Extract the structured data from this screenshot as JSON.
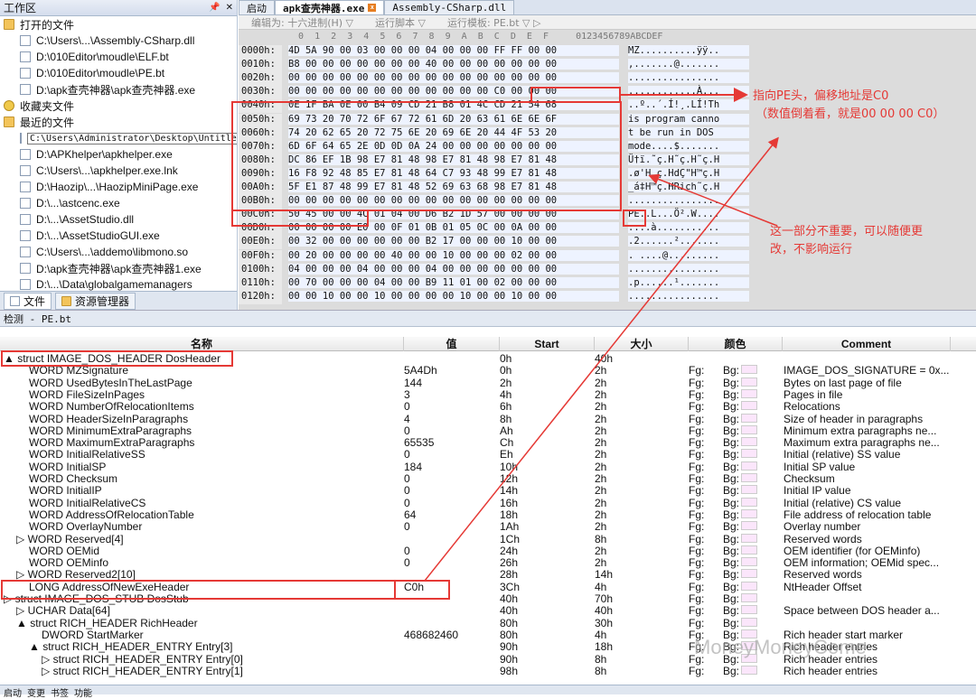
{
  "left_panel": {
    "title": "工作区",
    "sections": [
      {
        "label": "打开的文件",
        "icon": "folder-icon"
      },
      {
        "label": "收藏夹文件",
        "icon": "folder-icon"
      },
      {
        "label": "最近的文件",
        "icon": "folder-icon"
      }
    ],
    "open_files": [
      "C:\\Users\\...\\Assembly-CSharp.dll",
      "D:\\010Editor\\moudle\\ELF.bt",
      "D:\\010Editor\\moudle\\PE.bt",
      "D:\\apk查壳神器\\apk查壳神器.exe"
    ],
    "recent_files": [
      "C:\\Users\\Administrator\\Desktop\\Untitled",
      "D:\\APKhelper\\apkhelper.exe",
      "C:\\Users\\...\\apkhelper.exe.lnk",
      "D:\\Haozip\\...\\HaozipMiniPage.exe",
      "D:\\...\\astcenc.exe",
      "D:\\...\\AssetStudio.dll",
      "D:\\...\\AssetStudioGUI.exe",
      "C:\\Users\\...\\addemo\\libmono.so",
      "D:\\apk查壳神器\\apk查壳神器1.exe",
      "D:\\...\\Data\\globalgamemanagers"
    ],
    "tabs": [
      "文件",
      "资源管理器"
    ]
  },
  "hex_editor": {
    "tabs": [
      "启动",
      "apk查壳神器.exe",
      "Assembly-CSharp.dll"
    ],
    "toolbar": [
      "编辑为: 十六进制(H) ▽",
      "运行脚本 ▽",
      "运行模板: PE.bt ▽ ▷"
    ],
    "col_header": "  0  1  2  3  4  5  6  7  8  9  A  B  C  D  E  F     0123456789ABCDEF",
    "rows": [
      {
        "addr": "0000h:",
        "bytes": "4D 5A 90 00 03 00 00 00 04 00 00 00 FF FF 00 00",
        "ascii": "MZ..........ÿÿ.."
      },
      {
        "addr": "0010h:",
        "bytes": "B8 00 00 00 00 00 00 00 40 00 00 00 00 00 00 00",
        "ascii": ",.......@......."
      },
      {
        "addr": "0020h:",
        "bytes": "00 00 00 00 00 00 00 00 00 00 00 00 00 00 00 00",
        "ascii": "................"
      },
      {
        "addr": "0030h:",
        "bytes": "00 00 00 00 00 00 00 00 00 00 00 00 C0 00 00 00",
        "ascii": "............À..."
      },
      {
        "addr": "0040h:",
        "bytes": "0E 1F BA 0E 00 B4 09 CD 21 B8 01 4C CD 21 54 68",
        "ascii": "..º..´.Í!¸.LÍ!Th"
      },
      {
        "addr": "0050h:",
        "bytes": "69 73 20 70 72 6F 67 72 61 6D 20 63 61 6E 6E 6F",
        "ascii": "is program canno"
      },
      {
        "addr": "0060h:",
        "bytes": "74 20 62 65 20 72 75 6E 20 69 6E 20 44 4F 53 20",
        "ascii": "t be run in DOS "
      },
      {
        "addr": "0070h:",
        "bytes": "6D 6F 64 65 2E 0D 0D 0A 24 00 00 00 00 00 00 00",
        "ascii": "mode....$......."
      },
      {
        "addr": "0080h:",
        "bytes": "DC 86 EF 1B 98 E7 81 48 98 E7 81 48 98 E7 81 48",
        "ascii": "Ü†ï.˜ç.H˜ç.H˜ç.H"
      },
      {
        "addr": "0090h:",
        "bytes": "16 F8 92 48 85 E7 81 48 64 C7 93 48 99 E7 81 48",
        "ascii": ".ø'H…ç.HdÇ\"H™ç.H"
      },
      {
        "addr": "00A0h:",
        "bytes": "5F E1 87 48 99 E7 81 48 52 69 63 68 98 E7 81 48",
        "ascii": "_á‡H™ç.HRich˜ç.H"
      },
      {
        "addr": "00B0h:",
        "bytes": "00 00 00 00 00 00 00 00 00 00 00 00 00 00 00 00",
        "ascii": "................"
      },
      {
        "addr": "00C0h:",
        "bytes": "50 45 00 00 4C 01 04 00 D6 B2 1D 57 00 00 00 00",
        "ascii": "PE..L...Ö².W...."
      },
      {
        "addr": "00D0h:",
        "bytes": "00 00 00 00 E0 00 0F 01 0B 01 05 0C 00 0A 00 00",
        "ascii": "....à..........."
      },
      {
        "addr": "00E0h:",
        "bytes": "00 32 00 00 00 00 00 00 B2 17 00 00 00 10 00 00",
        "ascii": ".2......²......."
      },
      {
        "addr": "00F0h:",
        "bytes": "00 20 00 00 00 00 40 00 00 10 00 00 00 02 00 00",
        "ascii": ". ....@........."
      },
      {
        "addr": "0100h:",
        "bytes": "04 00 00 00 04 00 00 00 04 00 00 00 00 00 00 00",
        "ascii": "................"
      },
      {
        "addr": "0110h:",
        "bytes": "00 70 00 00 00 04 00 00 B9 11 01 00 02 00 00 00",
        "ascii": ".p......¹......."
      },
      {
        "addr": "0120h:",
        "bytes": "00 00 10 00 00 10 00 00 00 00 10 00 00 10 00 00",
        "ascii": "................"
      }
    ]
  },
  "annotations": {
    "pe_head": "指向PE头，偏移地址是C0",
    "pe_head2": "（数值倒着看，就是00 00 00 C0）",
    "stub_note": "这一部分不重要，可以随便更",
    "stub_note2": "改，不影响运行"
  },
  "inspector": {
    "title": "检测 - PE.bt",
    "headers": [
      "名称",
      "值",
      "Start",
      "大小",
      "颜色",
      "Comment"
    ],
    "rows": [
      {
        "indent": 0,
        "exp": "▲",
        "name": "struct IMAGE_DOS_HEADER DosHeader",
        "val": "",
        "start": "0h",
        "size": "40h",
        "fg": "",
        "bg": "",
        "cm": ""
      },
      {
        "indent": 2,
        "exp": "",
        "name": "WORD MZSignature",
        "val": "5A4Dh",
        "start": "0h",
        "size": "2h",
        "fg": "Fg:",
        "bg": "Bg:",
        "cm": "IMAGE_DOS_SIGNATURE = 0x..."
      },
      {
        "indent": 2,
        "exp": "",
        "name": "WORD UsedBytesInTheLastPage",
        "val": "144",
        "start": "2h",
        "size": "2h",
        "fg": "Fg:",
        "bg": "Bg:",
        "cm": "Bytes on last page of file"
      },
      {
        "indent": 2,
        "exp": "",
        "name": "WORD FileSizeInPages",
        "val": "3",
        "start": "4h",
        "size": "2h",
        "fg": "Fg:",
        "bg": "Bg:",
        "cm": "Pages in file"
      },
      {
        "indent": 2,
        "exp": "",
        "name": "WORD NumberOfRelocationItems",
        "val": "0",
        "start": "6h",
        "size": "2h",
        "fg": "Fg:",
        "bg": "Bg:",
        "cm": "Relocations"
      },
      {
        "indent": 2,
        "exp": "",
        "name": "WORD HeaderSizeInParagraphs",
        "val": "4",
        "start": "8h",
        "size": "2h",
        "fg": "Fg:",
        "bg": "Bg:",
        "cm": "Size of header in paragraphs"
      },
      {
        "indent": 2,
        "exp": "",
        "name": "WORD MinimumExtraParagraphs",
        "val": "0",
        "start": "Ah",
        "size": "2h",
        "fg": "Fg:",
        "bg": "Bg:",
        "cm": "Minimum extra paragraphs ne..."
      },
      {
        "indent": 2,
        "exp": "",
        "name": "WORD MaximumExtraParagraphs",
        "val": "65535",
        "start": "Ch",
        "size": "2h",
        "fg": "Fg:",
        "bg": "Bg:",
        "cm": "Maximum extra paragraphs ne..."
      },
      {
        "indent": 2,
        "exp": "",
        "name": "WORD InitialRelativeSS",
        "val": "0",
        "start": "Eh",
        "size": "2h",
        "fg": "Fg:",
        "bg": "Bg:",
        "cm": "Initial (relative) SS value"
      },
      {
        "indent": 2,
        "exp": "",
        "name": "WORD InitialSP",
        "val": "184",
        "start": "10h",
        "size": "2h",
        "fg": "Fg:",
        "bg": "Bg:",
        "cm": "Initial SP value"
      },
      {
        "indent": 2,
        "exp": "",
        "name": "WORD Checksum",
        "val": "0",
        "start": "12h",
        "size": "2h",
        "fg": "Fg:",
        "bg": "Bg:",
        "cm": "Checksum"
      },
      {
        "indent": 2,
        "exp": "",
        "name": "WORD InitialIP",
        "val": "0",
        "start": "14h",
        "size": "2h",
        "fg": "Fg:",
        "bg": "Bg:",
        "cm": "Initial IP value"
      },
      {
        "indent": 2,
        "exp": "",
        "name": "WORD InitialRelativeCS",
        "val": "0",
        "start": "16h",
        "size": "2h",
        "fg": "Fg:",
        "bg": "Bg:",
        "cm": "Initial (relative) CS value"
      },
      {
        "indent": 2,
        "exp": "",
        "name": "WORD AddressOfRelocationTable",
        "val": "64",
        "start": "18h",
        "size": "2h",
        "fg": "Fg:",
        "bg": "Bg:",
        "cm": "File address of relocation table"
      },
      {
        "indent": 2,
        "exp": "",
        "name": "WORD OverlayNumber",
        "val": "0",
        "start": "1Ah",
        "size": "2h",
        "fg": "Fg:",
        "bg": "Bg:",
        "cm": "Overlay number"
      },
      {
        "indent": 1,
        "exp": "▷",
        "name": "WORD Reserved[4]",
        "val": "",
        "start": "1Ch",
        "size": "8h",
        "fg": "Fg:",
        "bg": "Bg:",
        "cm": "Reserved words"
      },
      {
        "indent": 2,
        "exp": "",
        "name": "WORD OEMid",
        "val": "0",
        "start": "24h",
        "size": "2h",
        "fg": "Fg:",
        "bg": "Bg:",
        "cm": "OEM identifier (for OEMinfo)"
      },
      {
        "indent": 2,
        "exp": "",
        "name": "WORD OEMinfo",
        "val": "0",
        "start": "26h",
        "size": "2h",
        "fg": "Fg:",
        "bg": "Bg:",
        "cm": "OEM information; OEMid spec..."
      },
      {
        "indent": 1,
        "exp": "▷",
        "name": "WORD Reserved2[10]",
        "val": "",
        "start": "28h",
        "size": "14h",
        "fg": "Fg:",
        "bg": "Bg:",
        "cm": "Reserved words"
      },
      {
        "indent": 2,
        "exp": "",
        "name": "LONG AddressOfNewExeHeader",
        "val": "C0h",
        "start": "3Ch",
        "size": "4h",
        "fg": "Fg:",
        "bg": "Bg:",
        "cm": "NtHeader Offset"
      },
      {
        "indent": 0,
        "exp": "▷",
        "name": "struct IMAGE_DOS_STUB DosStub",
        "val": "",
        "start": "40h",
        "size": "70h",
        "fg": "Fg:",
        "bg": "Bg:",
        "cm": ""
      },
      {
        "indent": 1,
        "exp": "▷",
        "name": "UCHAR Data[64]",
        "val": "",
        "start": "40h",
        "size": "40h",
        "fg": "Fg:",
        "bg": "Bg:",
        "cm": "Space between DOS header a..."
      },
      {
        "indent": 1,
        "exp": "▲",
        "name": "struct RICH_HEADER RichHeader",
        "val": "",
        "start": "80h",
        "size": "30h",
        "fg": "Fg:",
        "bg": "Bg:",
        "cm": ""
      },
      {
        "indent": 3,
        "exp": "",
        "name": "DWORD StartMarker",
        "val": "468682460",
        "start": "80h",
        "size": "4h",
        "fg": "Fg:",
        "bg": "Bg:",
        "cm": "Rich header start marker"
      },
      {
        "indent": 2,
        "exp": "▲",
        "name": "struct RICH_HEADER_ENTRY Entry[3]",
        "val": "",
        "start": "90h",
        "size": "18h",
        "fg": "Fg:",
        "bg": "Bg:",
        "cm": "Rich header entries"
      },
      {
        "indent": 3,
        "exp": "▷",
        "name": "struct RICH_HEADER_ENTRY Entry[0]",
        "val": "",
        "start": "90h",
        "size": "8h",
        "fg": "Fg:",
        "bg": "Bg:",
        "cm": "Rich header entries"
      },
      {
        "indent": 3,
        "exp": "▷",
        "name": "struct RICH_HEADER_ENTRY Entry[1]",
        "val": "",
        "start": "98h",
        "size": "8h",
        "fg": "Fg:",
        "bg": "Bg:",
        "cm": "Rich header entries"
      }
    ],
    "bottom_tabs": [
      "启动",
      "变更",
      "书签",
      "功能"
    ]
  },
  "watermark": "MoneyMoneyCome"
}
